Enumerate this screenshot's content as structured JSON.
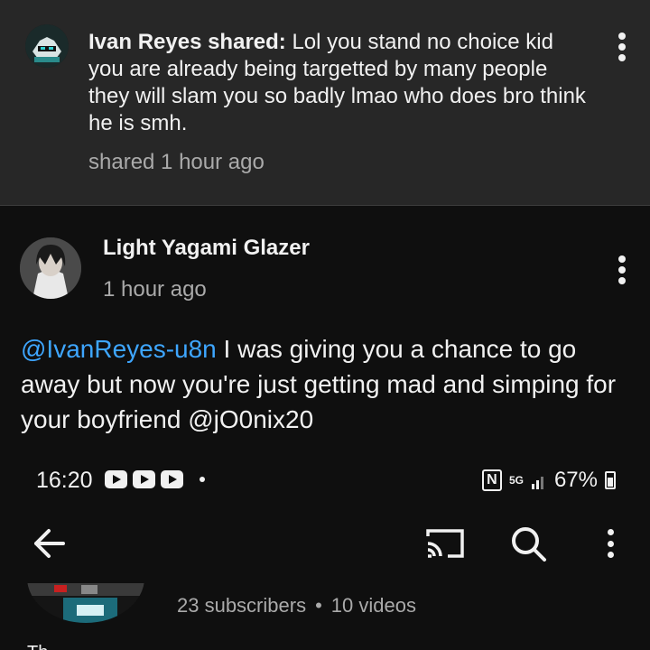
{
  "shared_post": {
    "author": "Ivan Reyes shared:",
    "text": " Lol you stand no choice kid you are already being targetted by many people they will slam you so badly lmao who does bro think he is smh.",
    "time": "shared 1 hour ago"
  },
  "comment": {
    "author": "Light Yagami Glazer",
    "time": "1 hour ago",
    "mention_1": "@IvanReyes-u8n",
    "body": " I was giving you a chance to go away but now you're just getting mad and simping for your boyfriend @jO0nix20"
  },
  "status_bar": {
    "time": "16:20",
    "network": "5G",
    "battery": "67%"
  },
  "channel": {
    "subscribers": "23 subscribers",
    "separator": "•",
    "videos": "10 videos",
    "peek_text": "Th..."
  },
  "colors": {
    "mention": "#3ea6ff",
    "background": "#0f0f0f",
    "card": "#272727",
    "secondary_text": "#aaaaaa"
  }
}
